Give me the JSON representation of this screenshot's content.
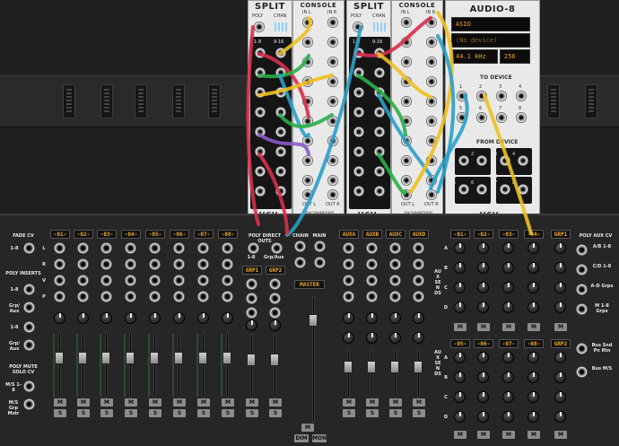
{
  "split1": {
    "title": "SPLIT",
    "poly_label": "POLY",
    "chan_label": "CHAN",
    "range1": "1-8",
    "range2": "9-16",
    "logo": "VCV"
  },
  "console1": {
    "title": "CONSOLE",
    "in_l": "IN L",
    "in_r": "IN R",
    "out_l": "OUT L",
    "out_r": "OUT R",
    "brand": "BACKWINDOWS"
  },
  "split2": {
    "title": "SPLIT",
    "poly_label": "POLY",
    "chan_label": "CHAN",
    "range1": "1-8",
    "range2": "9-16",
    "logo": "VCV"
  },
  "console2": {
    "title": "CONSOLE",
    "in_l": "IN L",
    "in_r": "IN R",
    "out_l": "OUT L",
    "out_r": "OUT R",
    "brand": "BACKWINDOWS"
  },
  "audio8": {
    "title": "AUDIO-8",
    "driver": "ASIO",
    "device": "(No device)",
    "sample_rate": "44.1 kHz",
    "block_size": "256",
    "to_device": "TO DEVICE",
    "from_device": "FROM DEVICE",
    "logo": "VCV",
    "to_nums": [
      "1",
      "2",
      "3",
      "4",
      "5",
      "6",
      "7",
      "8"
    ],
    "from_nums": [
      "1",
      "2",
      "3",
      "4",
      "5",
      "6",
      "7",
      "8"
    ]
  },
  "mixer": {
    "fade_cv": "FADE CV",
    "fade_range": "1-8",
    "poly_inserts": "POLY INSERTS",
    "ins_a": "1-8",
    "ins_b": "Grp/ Aux",
    "ins_c": "1-8",
    "ins_d": "Grp/ Aux",
    "poly_mute": "POLY MUTE SOLO CV",
    "mute_a": "M/S 1-8",
    "mute_b": "M/S Grp Mstr",
    "channels": [
      "-01-",
      "-02-",
      "-03-",
      "-04-",
      "-05-",
      "-06-",
      "-07-",
      "-08-"
    ],
    "row_labels": [
      "L",
      "R",
      "V",
      "P"
    ],
    "poly_direct": "POLY DIRECT OUTS",
    "direct_a": "1-8",
    "direct_b": "Grp/Aux",
    "groups": [
      "GRP1",
      "GRP2"
    ],
    "chain": "CHAIN",
    "main": "MAIN",
    "master": "MASTER",
    "dim": "DIM",
    "mon": "MON",
    "aux": [
      "AUXA",
      "AUXB",
      "AUXC",
      "AUXD"
    ],
    "aux_sends": "AUX SENDS",
    "send_channels_top": [
      "-01-",
      "-02-",
      "-03-",
      "-04-"
    ],
    "send_group_top": "GRP1",
    "send_channels_bottom": [
      "-05-",
      "-06-",
      "-07-",
      "-08-"
    ],
    "send_group_bottom": "GRP2",
    "send_rows": [
      "A",
      "B",
      "C",
      "D"
    ],
    "poly_aux_cv": "POLY AUX CV",
    "aux_cv": [
      "A/B 1-8",
      "C/D 1-8",
      "A-D Grps",
      "M 1-8 Grps",
      "Bus Snd Pn Rtn",
      "Bus M/S"
    ],
    "mute": "M",
    "solo": "S",
    "fader_scale": [
      "6",
      "0",
      "-6",
      "12",
      "18",
      "24",
      "48"
    ]
  }
}
